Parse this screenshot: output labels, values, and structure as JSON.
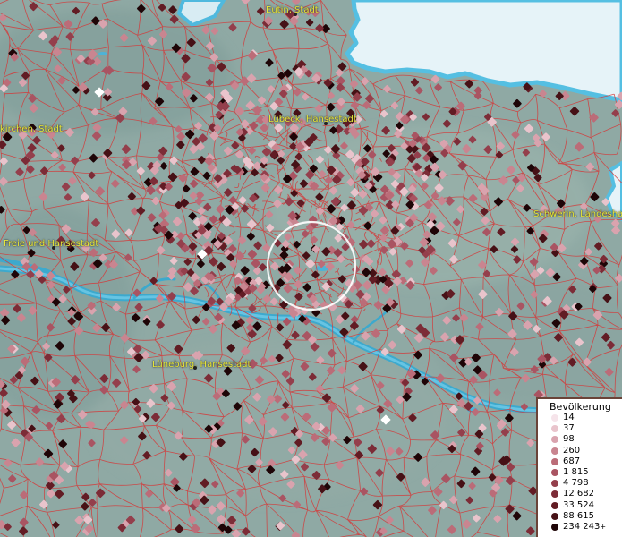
{
  "map": {
    "cities": [
      {
        "label": "Eutin, Stadt"
      },
      {
        "label": "kirchen, Stadt"
      },
      {
        "label": "Lübeck, Hansestadt"
      },
      {
        "label": "Schwerin, Landeshau"
      },
      {
        "label": "Freie und Hansestadt"
      },
      {
        "label": "Lüneburg, Hansestadt"
      }
    ]
  },
  "legend": {
    "title": "Bevölkerung",
    "items": [
      {
        "label": "14",
        "color": "#f6e4ea"
      },
      {
        "label": "37",
        "color": "#e9c4cc"
      },
      {
        "label": "98",
        "color": "#d9a3ae"
      },
      {
        "label": "260",
        "color": "#c98590"
      },
      {
        "label": "687",
        "color": "#bb6c78"
      },
      {
        "label": "1 815",
        "color": "#a95462"
      },
      {
        "label": "4 798",
        "color": "#943f4c"
      },
      {
        "label": "12 682",
        "color": "#7c2c37"
      },
      {
        "label": "33 524",
        "color": "#621c24"
      },
      {
        "label": "88 615",
        "color": "#461116"
      },
      {
        "label": "234 243",
        "color": "#1e0507"
      }
    ],
    "plus_mark": "+"
  },
  "colors": {
    "land": "#8fa9a4",
    "water_sea": "#e6f3f8",
    "water_river": "#35a3c8",
    "boundaries": "#d43a3a",
    "city_label": "#e8e83a"
  }
}
